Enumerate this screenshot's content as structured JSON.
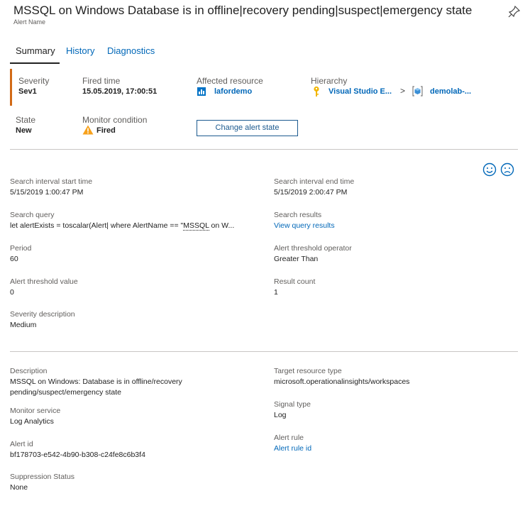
{
  "header": {
    "title": "MSSQL on Windows Database is in offline|recovery pending|suspect|emergency state",
    "subtitle": "Alert Name"
  },
  "tabs": [
    {
      "label": "Summary",
      "active": true
    },
    {
      "label": "History",
      "active": false
    },
    {
      "label": "Diagnostics",
      "active": false
    }
  ],
  "summary": {
    "severity": {
      "label": "Severity",
      "value": "Sev1"
    },
    "fired_time": {
      "label": "Fired time",
      "value": "15.05.2019, 17:00:51"
    },
    "affected_resource": {
      "label": "Affected resource",
      "value": "lafordemo"
    },
    "hierarchy": {
      "label": "Hierarchy",
      "item1": "Visual Studio E...",
      "separator": ">",
      "item2": "demolab-..."
    },
    "state": {
      "label": "State",
      "value": "New"
    },
    "monitor_condition": {
      "label": "Monitor condition",
      "value": "Fired"
    },
    "change_button": "Change alert state"
  },
  "feedback": {
    "smile_icon": "smile-icon",
    "frown_icon": "frown-icon"
  },
  "details": {
    "search_start_label": "Search interval start time",
    "search_start_value": "5/15/2019 1:00:47 PM",
    "search_end_label": "Search interval end time",
    "search_end_value": "5/15/2019 2:00:47 PM",
    "search_query_label": "Search query",
    "search_query_prefix": "let alertExists = toscalar(Alert| where AlertName == \"",
    "search_query_underlined": "MSSQL",
    "search_query_suffix": " on W...",
    "search_results_label": "Search results",
    "search_results_link": "View query results",
    "period_label": "Period",
    "period_value": "60",
    "threshold_op_label": "Alert threshold operator",
    "threshold_op_value": "Greater Than",
    "threshold_value_label": "Alert threshold value",
    "threshold_value_value": "0",
    "result_count_label": "Result count",
    "result_count_value": "1",
    "severity_desc_label": "Severity description",
    "severity_desc_value": "Medium"
  },
  "meta": {
    "description_label": "Description",
    "description_value": "MSSQL on Windows: Database is in offline/recovery pending/suspect/emergency state",
    "target_type_label": "Target resource type",
    "target_type_value": "microsoft.operationalinsights/workspaces",
    "monitor_service_label": "Monitor service",
    "monitor_service_value": "Log Analytics",
    "signal_type_label": "Signal type",
    "signal_type_value": "Log",
    "alert_id_label": "Alert id",
    "alert_id_value": "bf178703-e542-4b90-b308-c24fe8c6b3f4",
    "alert_rule_label": "Alert rule",
    "alert_rule_link": "Alert rule id",
    "suppression_label": "Suppression Status",
    "suppression_value": "None"
  },
  "colors": {
    "accent": "#d26a16",
    "link": "#0067b8",
    "warning": "#f7a11b"
  }
}
